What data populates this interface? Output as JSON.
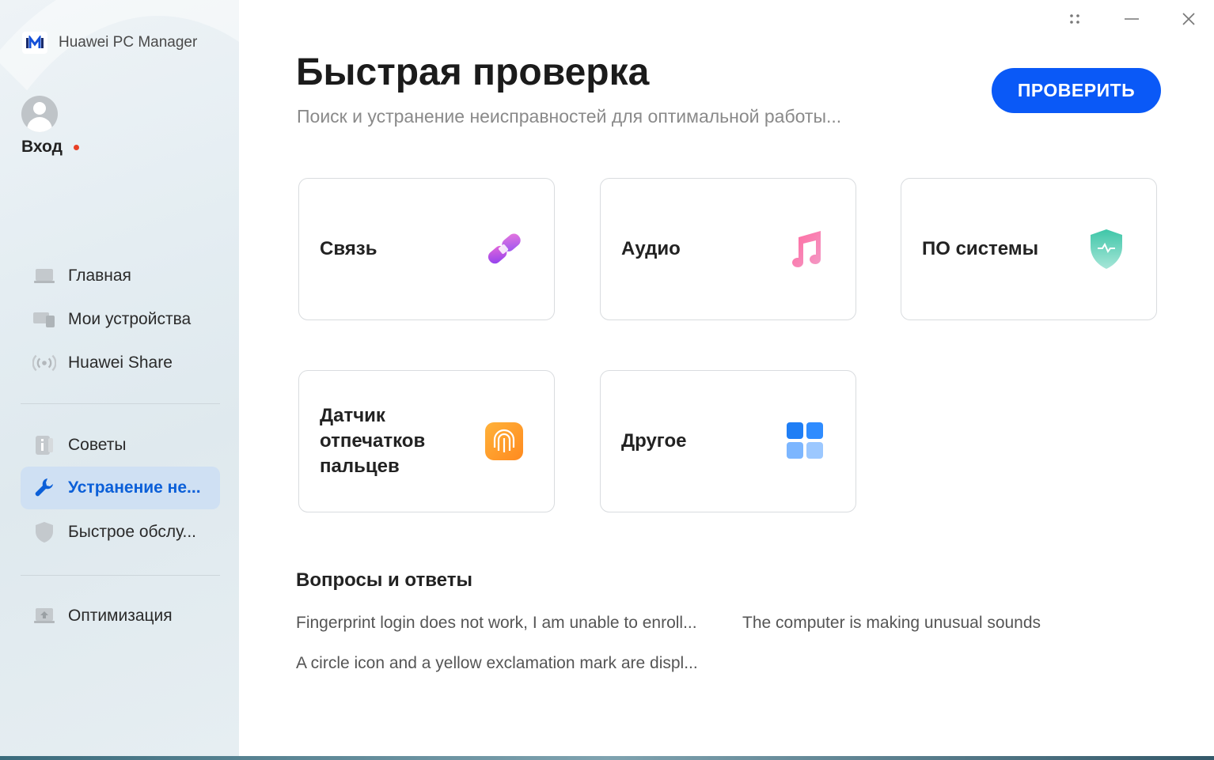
{
  "app": {
    "title": "Huawei PC Manager",
    "logo_text": "M"
  },
  "user": {
    "login_label": "Вход"
  },
  "sidebar": {
    "items": [
      {
        "label": "Главная",
        "icon": "laptop-icon"
      },
      {
        "label": "Мои устройства",
        "icon": "devices-icon"
      },
      {
        "label": "Huawei Share",
        "icon": "share-signal-icon"
      },
      {
        "label": "Советы",
        "icon": "tips-icon"
      },
      {
        "label": "Устранение не...",
        "icon": "wrench-icon",
        "active": true
      },
      {
        "label": "Быстрое обслу...",
        "icon": "shield-icon"
      },
      {
        "label": "Оптимизация",
        "icon": "optimize-icon"
      }
    ]
  },
  "main": {
    "title": "Быстрая проверка",
    "subtitle": "Поиск и устранение неисправностей для оптимальной работы...",
    "check_button": "ПРОВЕРИТЬ",
    "cards": [
      {
        "label": "Связь",
        "icon": "connection-link-icon"
      },
      {
        "label": "Аудио",
        "icon": "music-note-icon"
      },
      {
        "label": "ПО системы",
        "icon": "system-shield-icon"
      },
      {
        "label": "Датчик отпечатков пальцев",
        "icon": "fingerprint-icon"
      },
      {
        "label": "Другое",
        "icon": "grid-apps-icon"
      }
    ],
    "qa": {
      "title": "Вопросы и ответы",
      "links": [
        "Fingerprint login does not work, I am unable to enroll...",
        "The computer is making unusual sounds",
        "A circle icon and a yellow exclamation mark are displ..."
      ]
    }
  },
  "colors": {
    "accent": "#0a59f7",
    "active_nav_bg": "#cfe0f3",
    "active_nav_text": "#0b5fd8",
    "notification_dot": "#e84026"
  }
}
